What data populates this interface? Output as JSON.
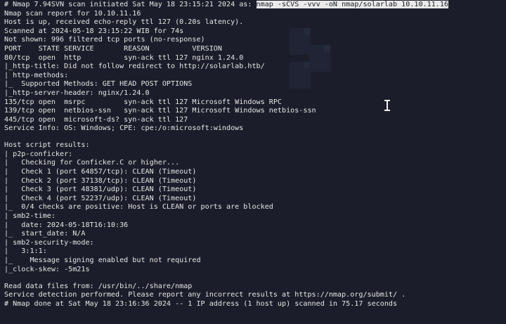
{
  "terminal": {
    "header": {
      "prefix": "# Nmap 7.94SVN scan initiated Sat May 18 23:15:21 2024 as: ",
      "command": "nmap -sCVS -vvv -oN nmap/solarlab 10.10.11.16"
    },
    "lines": [
      "Nmap scan report for 10.10.11.16",
      "Host is up, received echo-reply ttl 127 (0.20s latency).",
      "Scanned at 2024-05-18 23:15:22 WIB for 74s",
      "Not shown: 996 filtered tcp ports (no-response)",
      "PORT    STATE SERVICE       REASON          VERSION",
      "80/tcp  open  http          syn-ack ttl 127 nginx 1.24.0",
      "|_http-title: Did not follow redirect to http://solarlab.htb/",
      "| http-methods:",
      "|_  Supported Methods: GET HEAD POST OPTIONS",
      "|_http-server-header: nginx/1.24.0",
      "135/tcp open  msrpc         syn-ack ttl 127 Microsoft Windows RPC",
      "139/tcp open  netbios-ssn   syn-ack ttl 127 Microsoft Windows netbios-ssn",
      "445/tcp open  microsoft-ds? syn-ack ttl 127",
      "Service Info: OS: Windows; CPE: cpe:/o:microsoft:windows",
      "",
      "Host script results:",
      "| p2p-conficker:",
      "|   Checking for Conficker.C or higher...",
      "|   Check 1 (port 64857/tcp): CLEAN (Timeout)",
      "|   Check 2 (port 37138/tcp): CLEAN (Timeout)",
      "|   Check 3 (port 48381/udp): CLEAN (Timeout)",
      "|   Check 4 (port 52237/udp): CLEAN (Timeout)",
      "|_  0/4 checks are positive: Host is CLEAN or ports are blocked",
      "| smb2-time:",
      "|   date: 2024-05-18T16:10:36",
      "|_  start_date: N/A",
      "| smb2-security-mode:",
      "|   3:1:1:",
      "|_    Message signing enabled but not required",
      "|_clock-skew: -5m21s",
      "",
      "Read data files from: /usr/bin/../share/nmap",
      "Service detection performed. Please report any incorrect results at https://nmap.org/submit/ .",
      "# Nmap done at Sat May 18 23:16:36 2024 -- 1 IP address (1 host up) scanned in 75.17 seconds"
    ]
  },
  "colors": {
    "background": "#1b1e2a",
    "text": "#e6e6e6",
    "highlight_bg": "#eaeaea",
    "highlight_text": "#1b1e2a"
  },
  "cursor": {
    "icon": "text-cursor-ibeam-icon"
  }
}
